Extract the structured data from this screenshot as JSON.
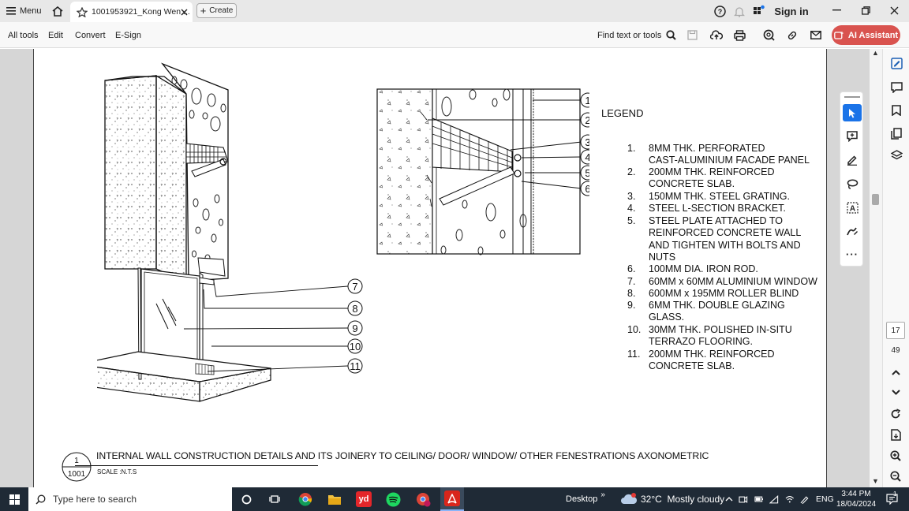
{
  "titlebar": {
    "menu_label": "Menu",
    "tab_title": "1001953921_Kong Wen ...",
    "create_label": "Create",
    "signin_label": "Sign in"
  },
  "toolbar": {
    "all_tools": "All tools",
    "edit": "Edit",
    "convert": "Convert",
    "esign": "E-Sign",
    "find_label": "Find text or tools",
    "ai_assistant": "AI Assistant"
  },
  "drawing": {
    "callouts_left": [
      "7",
      "8",
      "9",
      "10",
      "11"
    ],
    "callouts_detail": [
      "1",
      "2",
      "3",
      "4",
      "5",
      "6"
    ],
    "legend_title": "LEGEND",
    "legend": [
      {
        "num": "1.",
        "text": "8MM THK. PERFORATED\nCAST-ALUMINIUM FACADE PANEL"
      },
      {
        "num": "2.",
        "text": "200MM THK. REINFORCED\nCONCRETE SLAB."
      },
      {
        "num": "3.",
        "text": "150MM THK. STEEL GRATING."
      },
      {
        "num": "4.",
        "text": "STEEL L-SECTION BRACKET."
      },
      {
        "num": "5.",
        "text": "STEEL PLATE ATTACHED TO\nREINFORCED CONCRETE WALL\nAND TIGHTEN WITH BOLTS AND\nNUTS"
      },
      {
        "num": "6.",
        "text": "100MM DIA. IRON ROD."
      },
      {
        "num": "7.",
        "text": "60MM x 60MM ALUMINIUM WINDOW"
      },
      {
        "num": "8.",
        "text": "600MM x 195MM ROLLER BLIND"
      },
      {
        "num": "9.",
        "text": "6MM THK. DOUBLE GLAZING\nGLASS."
      },
      {
        "num": "10.",
        "text": "30MM THK. POLISHED IN-SITU\nTERRAZO FLOORING."
      },
      {
        "num": "11.",
        "text": "200MM THK. REINFORCED\nCONCRETE SLAB."
      }
    ],
    "title_ref_top": "1",
    "title_ref_bottom": "1001",
    "title": "INTERNAL WALL CONSTRUCTION DETAILS AND ITS JOINERY TO CEILING/ DOOR/ WINDOW/ OTHER FENESTRATIONS AXONOMETRIC",
    "scale": "SCALE :N.T.S"
  },
  "pager": {
    "current_page": "17",
    "total_pages": "49"
  },
  "taskbar": {
    "search_placeholder": "Type here to search",
    "desktop_label": "Desktop",
    "weather": "32°C  Mostly cloudy",
    "language": "ENG",
    "time": "3:44 PM",
    "date": "18/04/2024",
    "notification_count": "1"
  },
  "colors": {
    "ai_button": "#d9534f",
    "select_tool": "#1a73e8",
    "taskbar": "#1f2a36"
  }
}
